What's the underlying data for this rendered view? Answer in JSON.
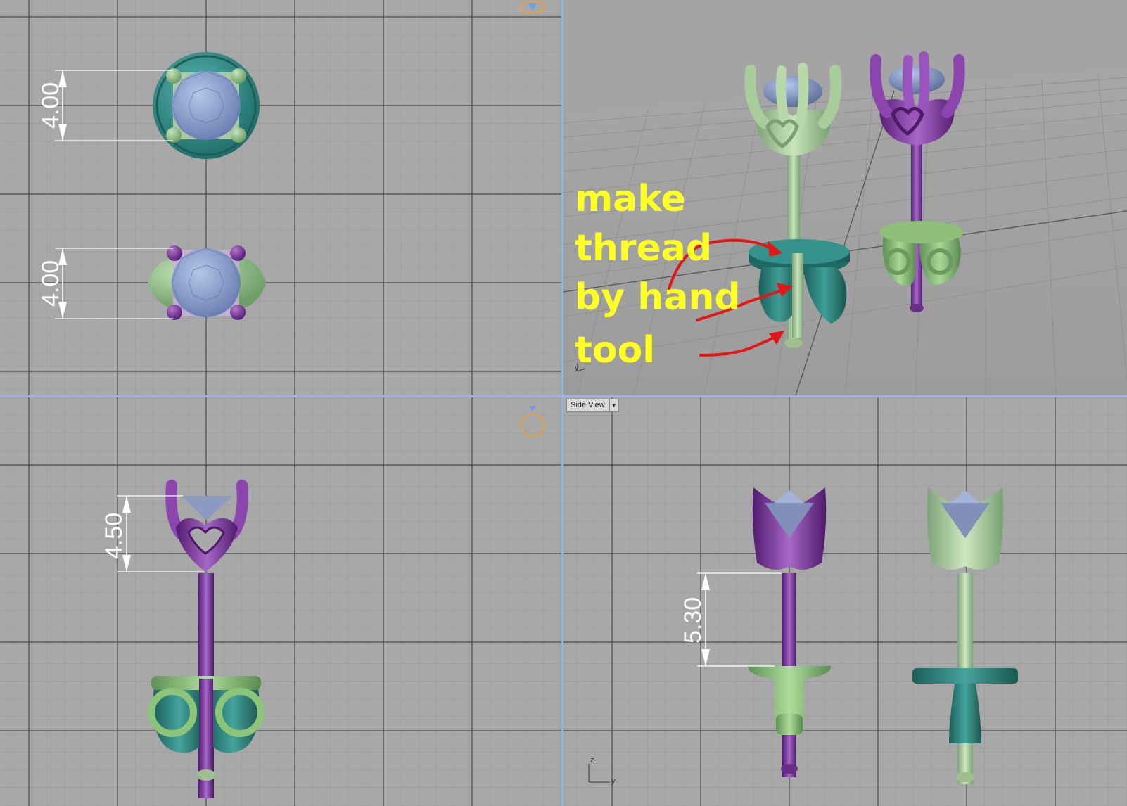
{
  "viewports": {
    "top": {
      "dims": [
        "4.00",
        "4.00"
      ]
    },
    "perspective": {
      "annotation_lines": [
        "make",
        "thread",
        "by hand",
        "tool"
      ],
      "axis_label": "y"
    },
    "front": {
      "dims": [
        "4.50"
      ]
    },
    "side": {
      "label": "Side View",
      "dropdown_icon": "triangle-down",
      "dims": [
        "5.30"
      ],
      "axis_labels": [
        "z",
        "y"
      ]
    }
  },
  "colors": {
    "viewport_bg": "#a8a8a8",
    "grid_minor": "#989898",
    "grid_major": "#4a4a4a",
    "divider": "#9fb3d8",
    "purple_metal": "#7a3a9a",
    "green_metal": "#8fc48a",
    "teal_metal": "#2f8a84",
    "light_green_metal": "#a9c99b",
    "gem": "#8ea4d0",
    "annotation_text": "#ffff26",
    "arrow": "#e01818",
    "dimension": "#ffffff",
    "gizmo": "#e8a040"
  }
}
